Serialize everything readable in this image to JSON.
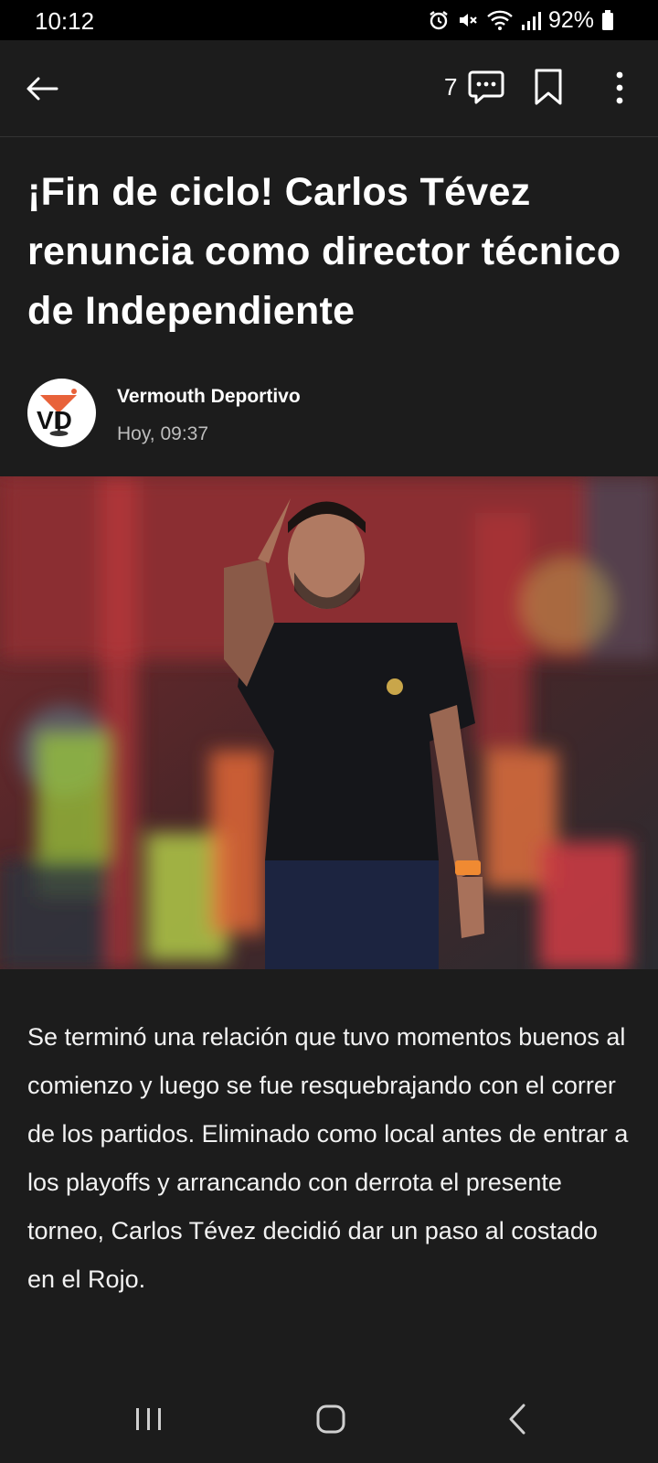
{
  "status_bar": {
    "time": "10:12",
    "battery_percent": "92%",
    "icons": [
      "alarm-icon",
      "mute-icon",
      "wifi-icon",
      "signal-icon",
      "battery-icon"
    ]
  },
  "app_bar": {
    "comment_count": "7",
    "icons": [
      "back-arrow-icon",
      "comment-icon",
      "bookmark-icon",
      "more-vertical-icon"
    ]
  },
  "article": {
    "title": "¡Fin de ciclo! Carlos Tévez renuncia como director técnico de Independiente",
    "author": "Vermouth Deportivo",
    "published": "Hoy, 09:37",
    "logo_text": "VD",
    "body": "Se terminó una relación que tuvo momentos buenos al comienzo y luego se fue resquebrajando con el correr de los partidos. Eliminado como local antes de entrar a los playoffs y arrancando con derrota el presente torneo, Carlos Tévez decidió dar un paso al costado en el Rojo."
  },
  "nav_bar": {
    "icons": [
      "recents-icon",
      "home-icon",
      "back-icon"
    ]
  },
  "colors": {
    "background": "#1c1c1c",
    "status_bar": "#000000",
    "text_primary": "#ffffff",
    "text_secondary": "#bdbdbd",
    "logo_accent": "#e8623a"
  }
}
